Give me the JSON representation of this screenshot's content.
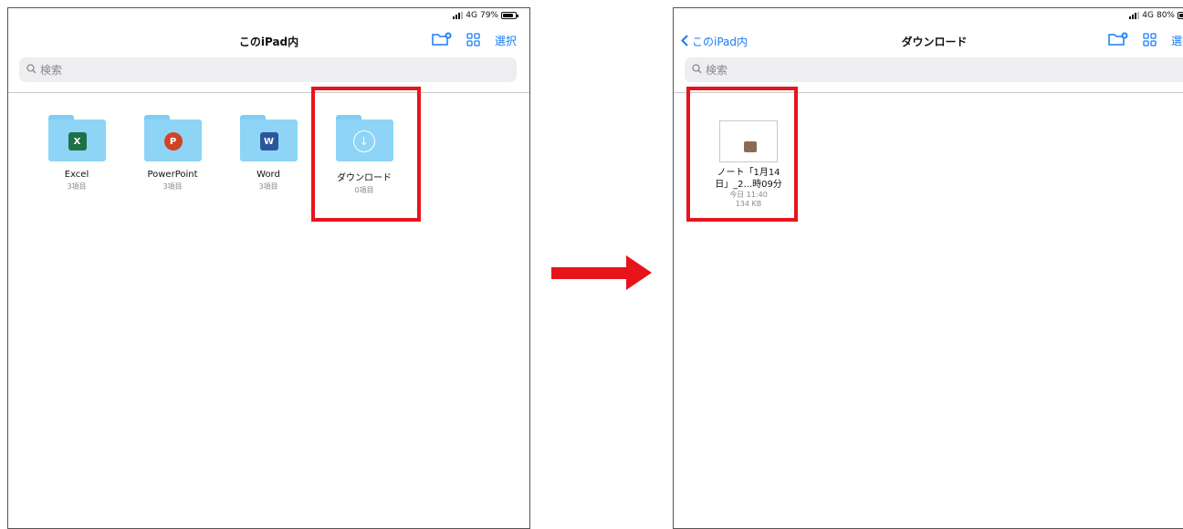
{
  "left_screen": {
    "status": {
      "network": "4G",
      "battery_text": "79%",
      "battery_level": 0.79
    },
    "nav": {
      "title": "このiPad内",
      "select_label": "選択"
    },
    "search": {
      "placeholder": "検索"
    },
    "folders": [
      {
        "name": "Excel",
        "count": "3項目",
        "icon": "excel-icon",
        "color": "#1e7145",
        "letter": "X"
      },
      {
        "name": "PowerPoint",
        "count": "3項目",
        "icon": "powerpoint-icon",
        "color": "#d04423",
        "letter": "P"
      },
      {
        "name": "Word",
        "count": "3項目",
        "icon": "word-icon",
        "color": "#2b579a",
        "letter": "W"
      },
      {
        "name": "ダウンロード",
        "count": "0項目",
        "icon": "download-icon"
      }
    ]
  },
  "right_screen": {
    "status": {
      "network": "4G",
      "battery_text": "80%",
      "battery_level": 0.8
    },
    "nav": {
      "back_label": "このiPad内",
      "title": "ダウンロード",
      "select_label": "選択"
    },
    "search": {
      "placeholder": "検索"
    },
    "file": {
      "name_line1": "ノート「1月14",
      "name_line2": "日」_2...時09分",
      "time": "今日 11:40",
      "size": "134 KB"
    }
  },
  "colors": {
    "accent": "#1a7cf5",
    "highlight": "#e8141b",
    "folder": "#8ed4f6"
  }
}
